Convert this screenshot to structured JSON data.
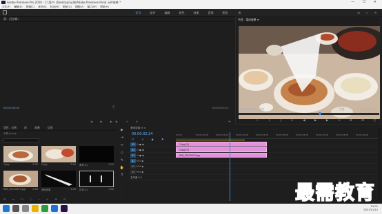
{
  "titlebar": {
    "title": "Adobe Premiere Pro 2020 - C:\\用户\\ (Desktop)\\示例\\Adobe Premiere Pro\\4 元件效果 *",
    "controls": "— ☐ ✕"
  },
  "menu": [
    "文件(F)",
    "编辑(E)",
    "剪辑(C)",
    "序列(S)",
    "标记(M)",
    "图形(G)",
    "视图(V)",
    "窗口(W)",
    "帮助(H)"
  ],
  "workspaces": [
    "学习",
    "组件",
    "编辑",
    "颜色",
    "效果",
    "音频",
    "图形",
    "库"
  ],
  "source": {
    "title": "源：(无剪辑)",
    "tc_left": "00;00;00;00",
    "tc_right": "00;00;00;00",
    "controls": "◀ ▶ ▶▶ ⇥ ⊕"
  },
  "program": {
    "title": "节目：滑动效果 ≡",
    "tc_current": "00:00:02:24",
    "fit": "适合",
    "zoom": "完整",
    "tc_end": "00:00:05:00",
    "controls": "⊢ { } ⇤ ◀ ▶ ▶ ⇥ ⊕ ⊡ ◻",
    "playhead_fraction": 0.58
  },
  "project": {
    "tabs": [
      "项目：示例",
      "库",
      "效果",
      "信息"
    ],
    "path": "示例.prproj",
    "items": [
      {
        "caption": "1.jpg",
        "dur": "5:00"
      },
      {
        "caption": "2.jpg",
        "dur": "5:00"
      },
      {
        "caption": "黑场 01",
        "dur": "5:00"
      },
      {
        "caption": "IMG_20210507.jpg",
        "dur": "5:00"
      },
      {
        "caption": "滑动效果",
        "dur": "5:00"
      },
      {
        "caption": "白场 01",
        "dur": "5:00"
      }
    ],
    "foot": "⊟ ≡ ☐ ○ ─ ⌂ ⊕ ⊡"
  },
  "tools": [
    "▶",
    "⇥",
    "⇔",
    "◇",
    "✎",
    "✋",
    "T"
  ],
  "timeline": {
    "tabs": "滑动效果 ≡  ×",
    "tc": "00:00:02:24",
    "icons": "⊓ ∩ ◆ ⚑",
    "ruler": [
      "00:00",
      "00:00:01:00",
      "00:00:02:00",
      "00:00:03:00",
      "00:00:04:00",
      "00:00:05:00",
      "00:00:06:00",
      "00:00:07:00",
      "00:00:08:00",
      "00:00:09:00"
    ],
    "tracks": [
      {
        "name": "V3",
        "label": "V3"
      },
      {
        "name": "V2",
        "label": "V2"
      },
      {
        "name": "V1",
        "label": "V1"
      },
      {
        "name": "A1",
        "label": "A1"
      },
      {
        "name": "A2",
        "label": "A2"
      },
      {
        "name": "A3",
        "label": "A3"
      },
      {
        "name": "主声道",
        "label": "0.0"
      }
    ],
    "clips": [
      "1.jpg [V]",
      "2.jpg [V]",
      "IMG_20210507.jpg"
    ]
  },
  "taskbar": {
    "time": "19:01",
    "date": "2021/11/12"
  },
  "watermark": "最需教育"
}
